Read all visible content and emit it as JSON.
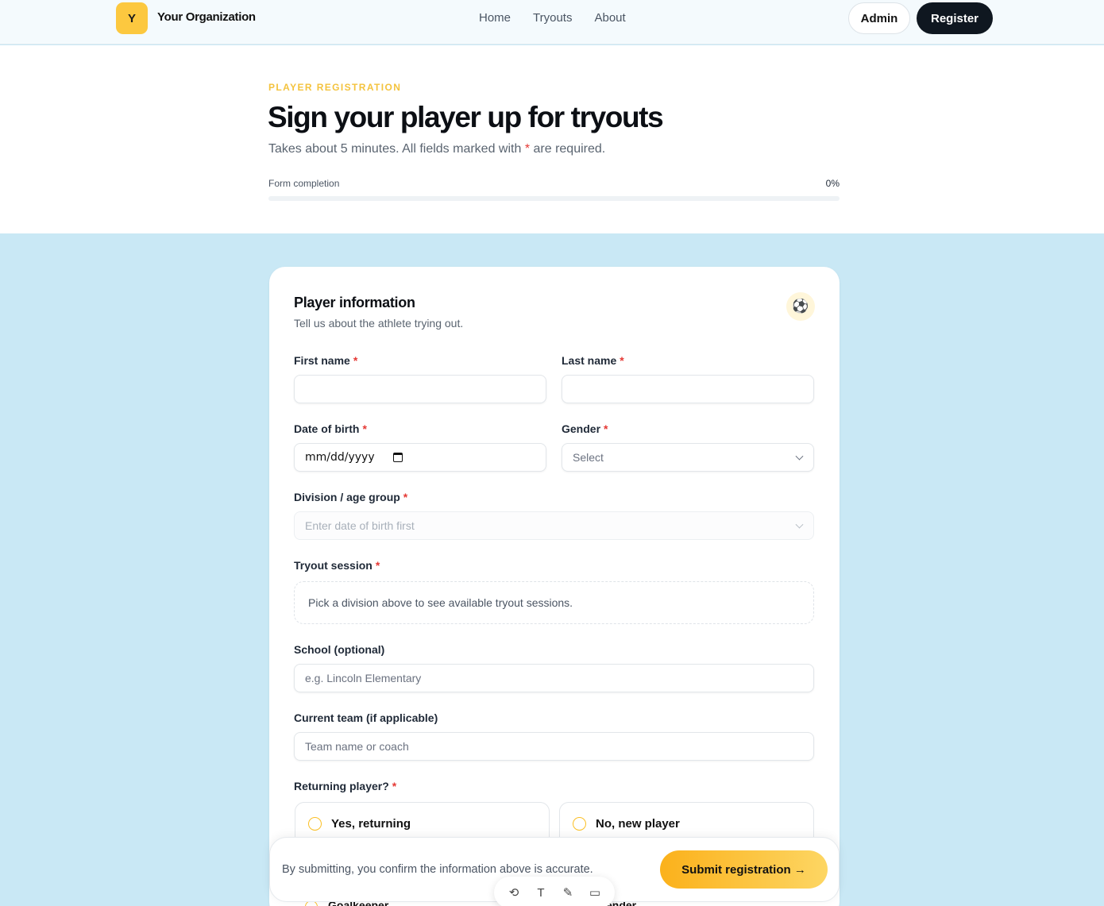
{
  "header": {
    "logo_letter": "Y",
    "org_name": "Your Organization",
    "nav": [
      "Home",
      "Tryouts",
      "About"
    ],
    "admin_label": "Admin",
    "register_label": "Register"
  },
  "hero": {
    "eyebrow": "PLAYER REGISTRATION",
    "title": "Sign your player up for tryouts",
    "subtitle_before": "Takes about 5 minutes. All fields marked with ",
    "subtitle_star": "*",
    "subtitle_after": " are required.",
    "progress_label": "Form completion",
    "progress_value": "0%",
    "progress_fraction": 0
  },
  "card": {
    "title": "Player information",
    "subtitle": "Tell us about the athlete trying out.",
    "icon": "soccer-ball-icon",
    "first_name_label": "First name",
    "last_name_label": "Last name",
    "dob_label": "Date of birth",
    "dob_value": "mm/dd/yyyy",
    "gender_label": "Gender",
    "gender_value": "Select",
    "division_label": "Division / age group",
    "division_placeholder": "Enter date of birth first",
    "session_label": "Tryout session",
    "session_hint": "Pick a division above to see available tryout sessions.",
    "school_label": "School (optional)",
    "school_placeholder": "e.g. Lincoln Elementary",
    "team_label": "Current team (if applicable)",
    "team_placeholder": "Team name or coach",
    "returning_label": "Returning player?",
    "returning_options": [
      "Yes, returning",
      "No, new player"
    ],
    "required_star": "*",
    "partial_below_left": "Goalkeeper",
    "partial_below_right": "ender"
  },
  "submit": {
    "confirm_text": "By submitting, you confirm the information above is accurate.",
    "button_label": "Submit registration →"
  },
  "colors": {
    "accent": "#fbbf24",
    "background": "#c9e8f5",
    "dark": "#0f1720",
    "required": "#e53935"
  }
}
